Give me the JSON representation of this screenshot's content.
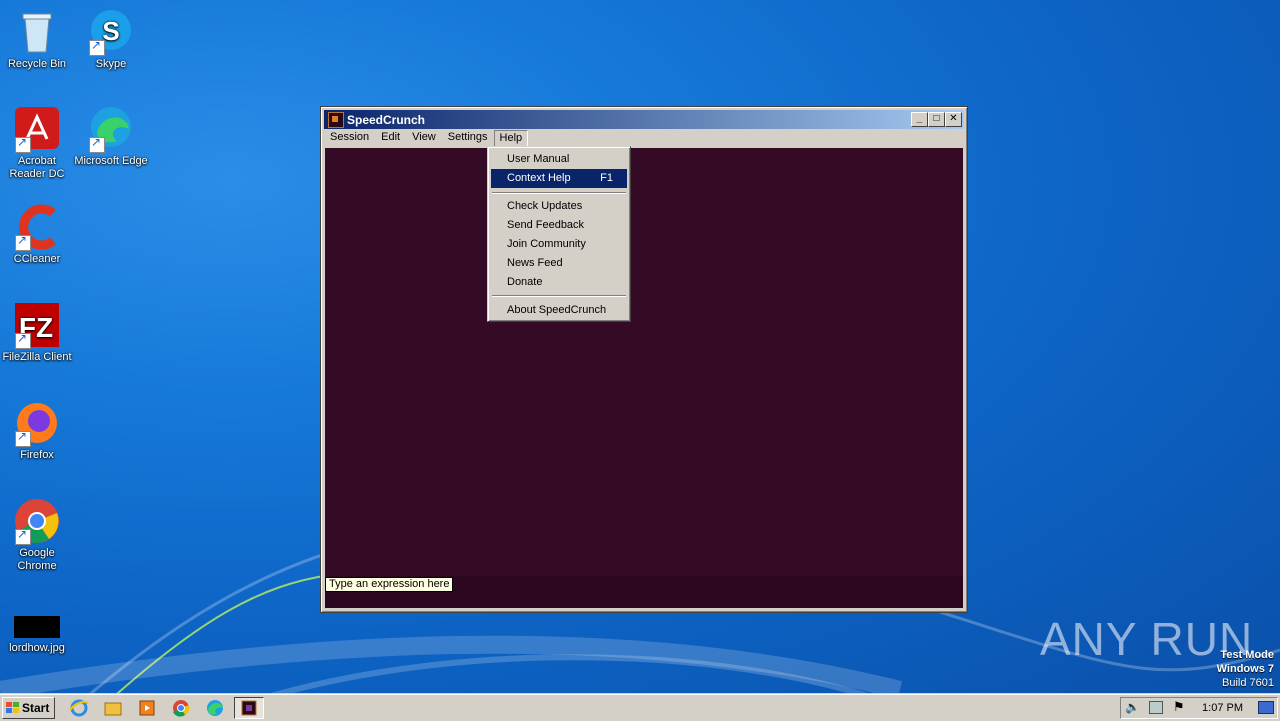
{
  "desktop": {
    "icons": [
      {
        "label": "Recycle Bin"
      },
      {
        "label": "Skype"
      },
      {
        "label": "Acrobat Reader DC"
      },
      {
        "label": "Microsoft Edge"
      },
      {
        "label": "CCleaner"
      },
      {
        "label": "FileZilla Client"
      },
      {
        "label": "Firefox"
      },
      {
        "label": "Google Chrome"
      },
      {
        "label": "lordhow.jpg"
      }
    ]
  },
  "window": {
    "title": "SpeedCrunch",
    "menu": [
      "Session",
      "Edit",
      "View",
      "Settings",
      "Help"
    ],
    "expression_placeholder": "Type an expression here"
  },
  "help_menu": {
    "items": [
      {
        "label": "User Manual",
        "shortcut": ""
      },
      {
        "label": "Context Help",
        "shortcut": "F1"
      },
      {
        "label": "Check Updates",
        "shortcut": ""
      },
      {
        "label": "Send Feedback",
        "shortcut": ""
      },
      {
        "label": "Join Community",
        "shortcut": ""
      },
      {
        "label": "News Feed",
        "shortcut": ""
      },
      {
        "label": "Donate",
        "shortcut": ""
      },
      {
        "label": "About SpeedCrunch",
        "shortcut": ""
      }
    ],
    "highlighted": "Context Help"
  },
  "taskbar": {
    "start_label": "Start",
    "clock": "1:07 PM"
  },
  "watermark": {
    "text": "ANY RUN"
  },
  "os_notice": {
    "line1": "Test Mode",
    "line2": "Windows 7",
    "line3": "Build 7601"
  },
  "colors": {
    "calculator_bg": "#340a24",
    "menu_highlight": "#0a246a",
    "desktop_blue": "#1679d8"
  }
}
